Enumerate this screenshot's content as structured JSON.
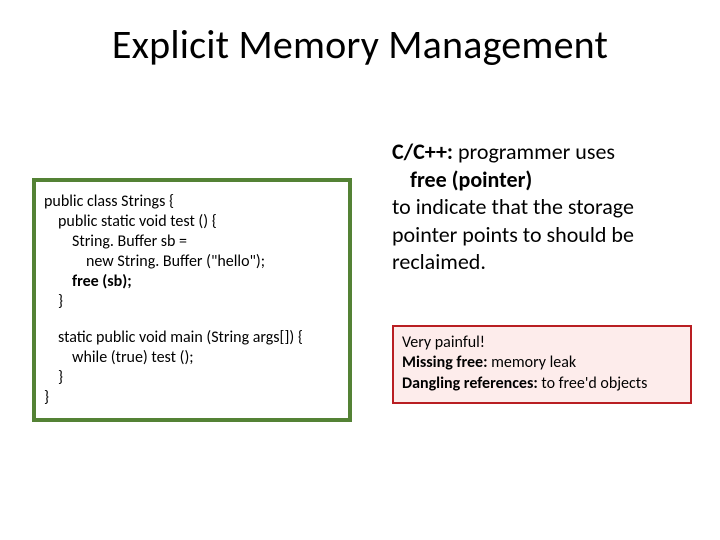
{
  "title": "Explicit Memory Management",
  "code": {
    "l1": "public class Strings {",
    "l2": "public static void test () {",
    "l3": "String. Buffer sb =",
    "l4": "new String. Buffer (\"hello\");",
    "l5a": "free (sb);",
    "l6": "}",
    "l7": "static public void main (String args[]) {",
    "l8": "while (true) test ();",
    "l9": "}",
    "l10": "}"
  },
  "right": {
    "l1a": "C/C++:",
    "l1b": " programmer uses",
    "l2a": "free (pointer)",
    "l3": "to indicate that the storage",
    "l4": "pointer points to should be",
    "l5": "reclaimed."
  },
  "pain": {
    "l1": "Very painful!",
    "l2a": "Missing free:",
    "l2b": " memory leak",
    "l3a": "Dangling references:",
    "l3b": " to free'd objects"
  }
}
